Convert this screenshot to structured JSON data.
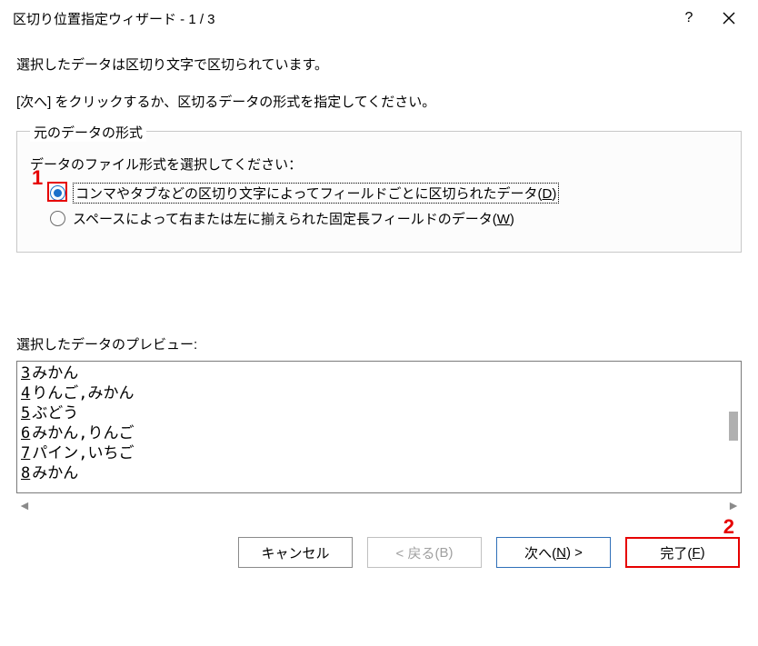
{
  "titlebar": {
    "title": "区切り位置指定ウィザード - 1 / 3"
  },
  "messages": {
    "line1": "選択したデータは区切り文字で区切られています。",
    "line2": "[次へ] をクリックするか、区切るデータの形式を指定してください。"
  },
  "fieldset": {
    "legend": "元のデータの形式",
    "prompt": "データのファイル形式を選択してください：",
    "options": [
      {
        "label_pre": "コンマやタブなどの区切り文字によってフィールドごとに区切られたデータ(",
        "key": "D",
        "label_post": ")",
        "checked": true
      },
      {
        "label_pre": "スペースによって右または左に揃えられた固定長フィールドのデータ(",
        "key": "W",
        "label_post": ")",
        "checked": false
      }
    ]
  },
  "preview": {
    "label": "選択したデータのプレビュー:",
    "rows": [
      {
        "n": "3",
        "text": "みかん"
      },
      {
        "n": "4",
        "text": "りんご,みかん"
      },
      {
        "n": "5",
        "text": "ぶどう"
      },
      {
        "n": "6",
        "text": "みかん,りんご"
      },
      {
        "n": "7",
        "text": "パイン,いちご"
      },
      {
        "n": "8",
        "text": "みかん"
      }
    ]
  },
  "buttons": {
    "cancel": "キャンセル",
    "back_pre": "< 戻る(",
    "back_key": "B",
    "back_post": ")",
    "next_pre": "次へ(",
    "next_key": "N",
    "next_post": ") >",
    "finish_pre": "完了(",
    "finish_key": "F",
    "finish_post": ")"
  },
  "annotations": {
    "r1": "1",
    "r2": "2"
  }
}
